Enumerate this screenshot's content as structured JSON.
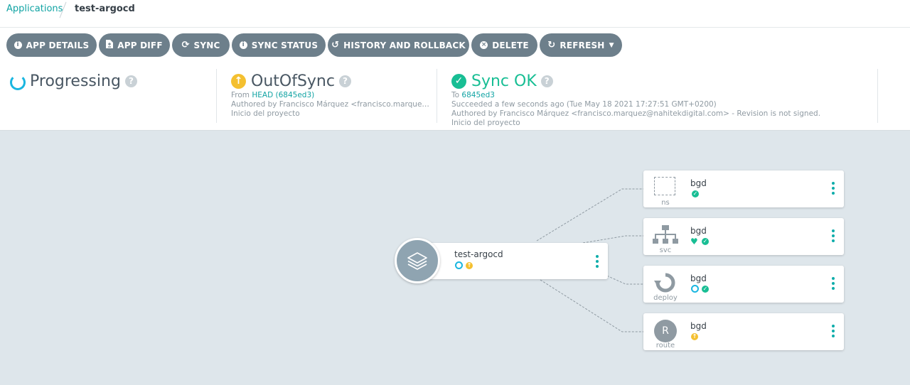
{
  "breadcrumb": {
    "root": "Applications",
    "current": "test-argocd"
  },
  "toolbar": {
    "app_details": "APP DETAILS",
    "app_diff": "APP DIFF",
    "sync": "SYNC",
    "sync_status": "SYNC STATUS",
    "history": "HISTORY AND ROLLBACK",
    "delete": "DELETE",
    "refresh": "REFRESH"
  },
  "health": {
    "title": "Progressing"
  },
  "sync_status": {
    "title": "OutOfSync",
    "from_label": "From",
    "from_rev": "HEAD (6845ed3)",
    "author": "Authored by Francisco Márquez <francisco.marquez…",
    "message": "Inicio del proyecto"
  },
  "operation": {
    "title": "Sync OK",
    "to_label": "To",
    "to_rev": "6845ed3",
    "succeeded": "Succeeded a few seconds ago (Tue May 18 2021 17:27:51 GMT+0200)",
    "author": "Authored by Francisco Márquez <francisco.marquez@nahitekdigital.com> - Revision is not signed.",
    "message": "Inicio del proyecto"
  },
  "graph": {
    "app": {
      "name": "test-argocd",
      "icon": "layers-icon"
    },
    "resources": [
      {
        "name": "bgd",
        "kind": "ns",
        "icon": "namespace-icon"
      },
      {
        "name": "bgd",
        "kind": "svc",
        "icon": "service-icon"
      },
      {
        "name": "bgd",
        "kind": "deploy",
        "icon": "deployment-icon"
      },
      {
        "name": "bgd",
        "kind": "route",
        "icon": "route-icon",
        "icon_letter": "R"
      }
    ]
  },
  "colors": {
    "accent": "#10a3a3",
    "button": "#6d7f8b",
    "healthy": "#18be94",
    "outofsync": "#f4c030",
    "progressing": "#1ab6e0"
  }
}
